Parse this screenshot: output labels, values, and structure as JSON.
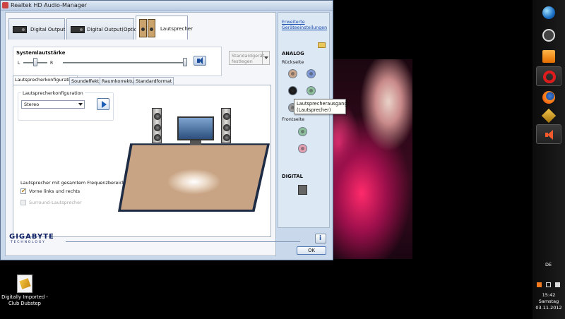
{
  "window": {
    "title": "Realtek HD Audio-Manager"
  },
  "device_tabs": [
    {
      "label": "Digital Output"
    },
    {
      "label": "Digital Output(Optical)"
    },
    {
      "label": "Lautsprecher"
    }
  ],
  "volume": {
    "label": "Systemlautstärke",
    "left_label": "L",
    "right_label": "R",
    "balance_level": 0.5,
    "volume_level": 1.0,
    "default_device_label": "Standardgerät festlegen"
  },
  "sub_tabs": [
    {
      "label": "Lautsprecherkonfiguration"
    },
    {
      "label": "Soundeffekt"
    },
    {
      "label": "Raumkorrektur"
    },
    {
      "label": "Standardformat"
    }
  ],
  "config": {
    "group_label": "Lautsprecherkonfiguration",
    "selected": "Stereo"
  },
  "fullrange": {
    "group_label": "Lautsprecher mit gesamtem Frequenzbereich",
    "front_label": "Vorne links und rechts",
    "front_checked": true,
    "surround_label": "Surround-Lautsprecher",
    "surround_checked": false
  },
  "right_panel": {
    "advanced_link": "Erweiterte Geräteeinstellungen",
    "analog_label": "ANALOG",
    "back_label": "Rückseite",
    "front_label": "Frontseite",
    "digital_label": "DIGITAL",
    "jack_colors": {
      "orange": "#c7a58a",
      "blue": "#7f9ad6",
      "black": "#1b1b1b",
      "green": "#8fc09d",
      "grey": "#9b9b9b",
      "front_green": "#8fc09d",
      "front_pink": "#e4a1b2"
    }
  },
  "tooltip": {
    "line1": "Lautsprecherausgang",
    "line2": "(Lautsprecher)"
  },
  "footer": {
    "brand": "GIGABYTE",
    "brand_sub": "TECHNOLOGY",
    "ok_label": "OK"
  },
  "desktop": {
    "icon_label": "Digitally Imported - Club Dubstep"
  },
  "taskbar": {
    "apps": [
      "windows-start",
      "steam",
      "media-player",
      "opera",
      "firefox",
      "winamp",
      "realtek-audio"
    ],
    "language": "DE",
    "time": "15:42",
    "day": "Samstag",
    "date": "03.11.2012"
  }
}
